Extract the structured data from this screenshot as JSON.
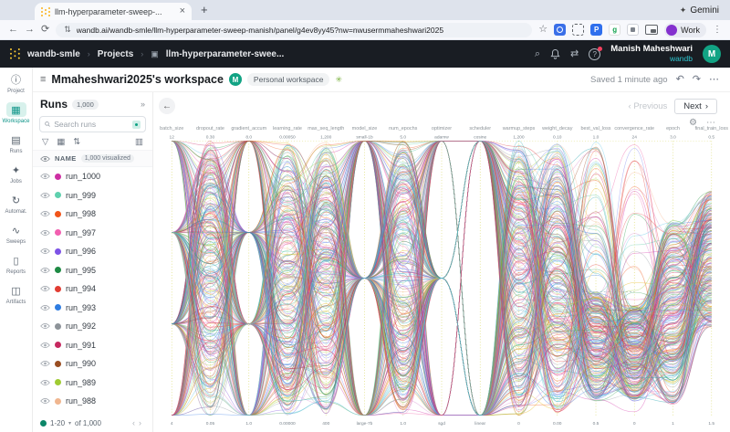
{
  "browser": {
    "tab_title": "llm-hyperparameter-sweep-...",
    "gemini_label": "Gemini",
    "url": "wandb.ai/wandb-smle/llm-hyperparameter-sweep-manish/panel/g4ev8yy45?nw=nwusermmaheshwari2025",
    "profile_label": "Work"
  },
  "topnav": {
    "breadcrumb_entity": "wandb-smle",
    "breadcrumb_projects": "Projects",
    "breadcrumb_project": "llm-hyperparameter-swee...",
    "user_name": "Manish Maheshwari",
    "user_org": "wandb",
    "avatar_initial": "M"
  },
  "rail": {
    "items": [
      {
        "label": "Project",
        "icon": "info-icon",
        "active": false
      },
      {
        "label": "Workspace",
        "icon": "workspace-icon",
        "active": true
      },
      {
        "label": "Runs",
        "icon": "runs-table-icon",
        "active": false
      },
      {
        "label": "Jobs",
        "icon": "jobs-icon",
        "active": false
      },
      {
        "label": "Automat.",
        "icon": "automations-icon",
        "active": false
      },
      {
        "label": "Sweeps",
        "icon": "sweeps-icon",
        "active": false
      },
      {
        "label": "Reports",
        "icon": "reports-icon",
        "active": false
      },
      {
        "label": "Artifacts",
        "icon": "artifacts-icon",
        "active": false
      }
    ]
  },
  "header": {
    "title": "Mmaheshwari2025's workspace",
    "badge_initial": "M",
    "workspace_badge": "Personal workspace",
    "saved_status": "Saved 1 minute ago",
    "prev_label": "Previous",
    "next_label": "Next"
  },
  "runs_panel": {
    "title": "Runs",
    "count_badge": "1,000",
    "search_placeholder": "Search runs",
    "name_header": "NAME",
    "visualized_badge": "1,000 visualized",
    "runs": [
      {
        "name": "run_1000",
        "color": "#cd2fa3"
      },
      {
        "name": "run_999",
        "color": "#5fd0ae"
      },
      {
        "name": "run_998",
        "color": "#f1551a"
      },
      {
        "name": "run_997",
        "color": "#f25fb0"
      },
      {
        "name": "run_996",
        "color": "#7d53e6"
      },
      {
        "name": "run_995",
        "color": "#1e8a44"
      },
      {
        "name": "run_994",
        "color": "#e13d33"
      },
      {
        "name": "run_993",
        "color": "#2f7de1"
      },
      {
        "name": "run_992",
        "color": "#8d9399"
      },
      {
        "name": "run_991",
        "color": "#c62960"
      },
      {
        "name": "run_990",
        "color": "#9a4e22"
      },
      {
        "name": "run_989",
        "color": "#9fcb33"
      },
      {
        "name": "run_988",
        "color": "#f0b68f"
      }
    ],
    "pagination": {
      "range": "1-20",
      "of": "of 1,000"
    }
  },
  "chart_data": {
    "type": "parallel-coordinates",
    "title": "",
    "line_count": 1000,
    "rendered_lines": 300,
    "legend": "none",
    "grid": "dotted-vertical-axes",
    "axes": [
      {
        "label": "batch_size",
        "top": "12",
        "bottom": "4"
      },
      {
        "label": "dropout_rate",
        "top": "0.30",
        "bottom": "0.05"
      },
      {
        "label": "gradient_accum",
        "top": "8.0",
        "bottom": "1.0"
      },
      {
        "label": "learning_rate",
        "top": "0.00050",
        "bottom": "0.00000"
      },
      {
        "label": "max_seq_length",
        "top": "1,200",
        "bottom": "400"
      },
      {
        "label": "model_size",
        "top": "small-1b",
        "bottom": "large-7b"
      },
      {
        "label": "num_epochs",
        "top": "5.0",
        "bottom": "1.0"
      },
      {
        "label": "optimizer",
        "top": "adamw",
        "bottom": "sgd"
      },
      {
        "label": "scheduler",
        "top": "cosine",
        "bottom": "linear"
      },
      {
        "label": "warmup_steps",
        "top": "1,200",
        "bottom": "0"
      },
      {
        "label": "weight_decay",
        "top": "0.10",
        "bottom": "0.00"
      },
      {
        "label": "best_val_loss",
        "top": "1.0",
        "bottom": "0.5"
      },
      {
        "label": "convergence_rate",
        "top": "24",
        "bottom": "0"
      },
      {
        "label": "epoch",
        "top": "3.0",
        "bottom": "1"
      },
      {
        "label": "final_train_loss",
        "top": "0.5",
        "bottom": "1.5"
      }
    ],
    "palette": [
      "#d63bae",
      "#53c7a4",
      "#f4571e",
      "#ef5fa7",
      "#8655e0",
      "#2c9e4b",
      "#e33e3e",
      "#3b7fe8",
      "#98a0a8",
      "#cf2d6e",
      "#a0522d",
      "#a6ce3a",
      "#f5b48d",
      "#18a0ab",
      "#e8b816",
      "#5ec8ea",
      "#7a7ff0",
      "#d98ad1"
    ]
  }
}
